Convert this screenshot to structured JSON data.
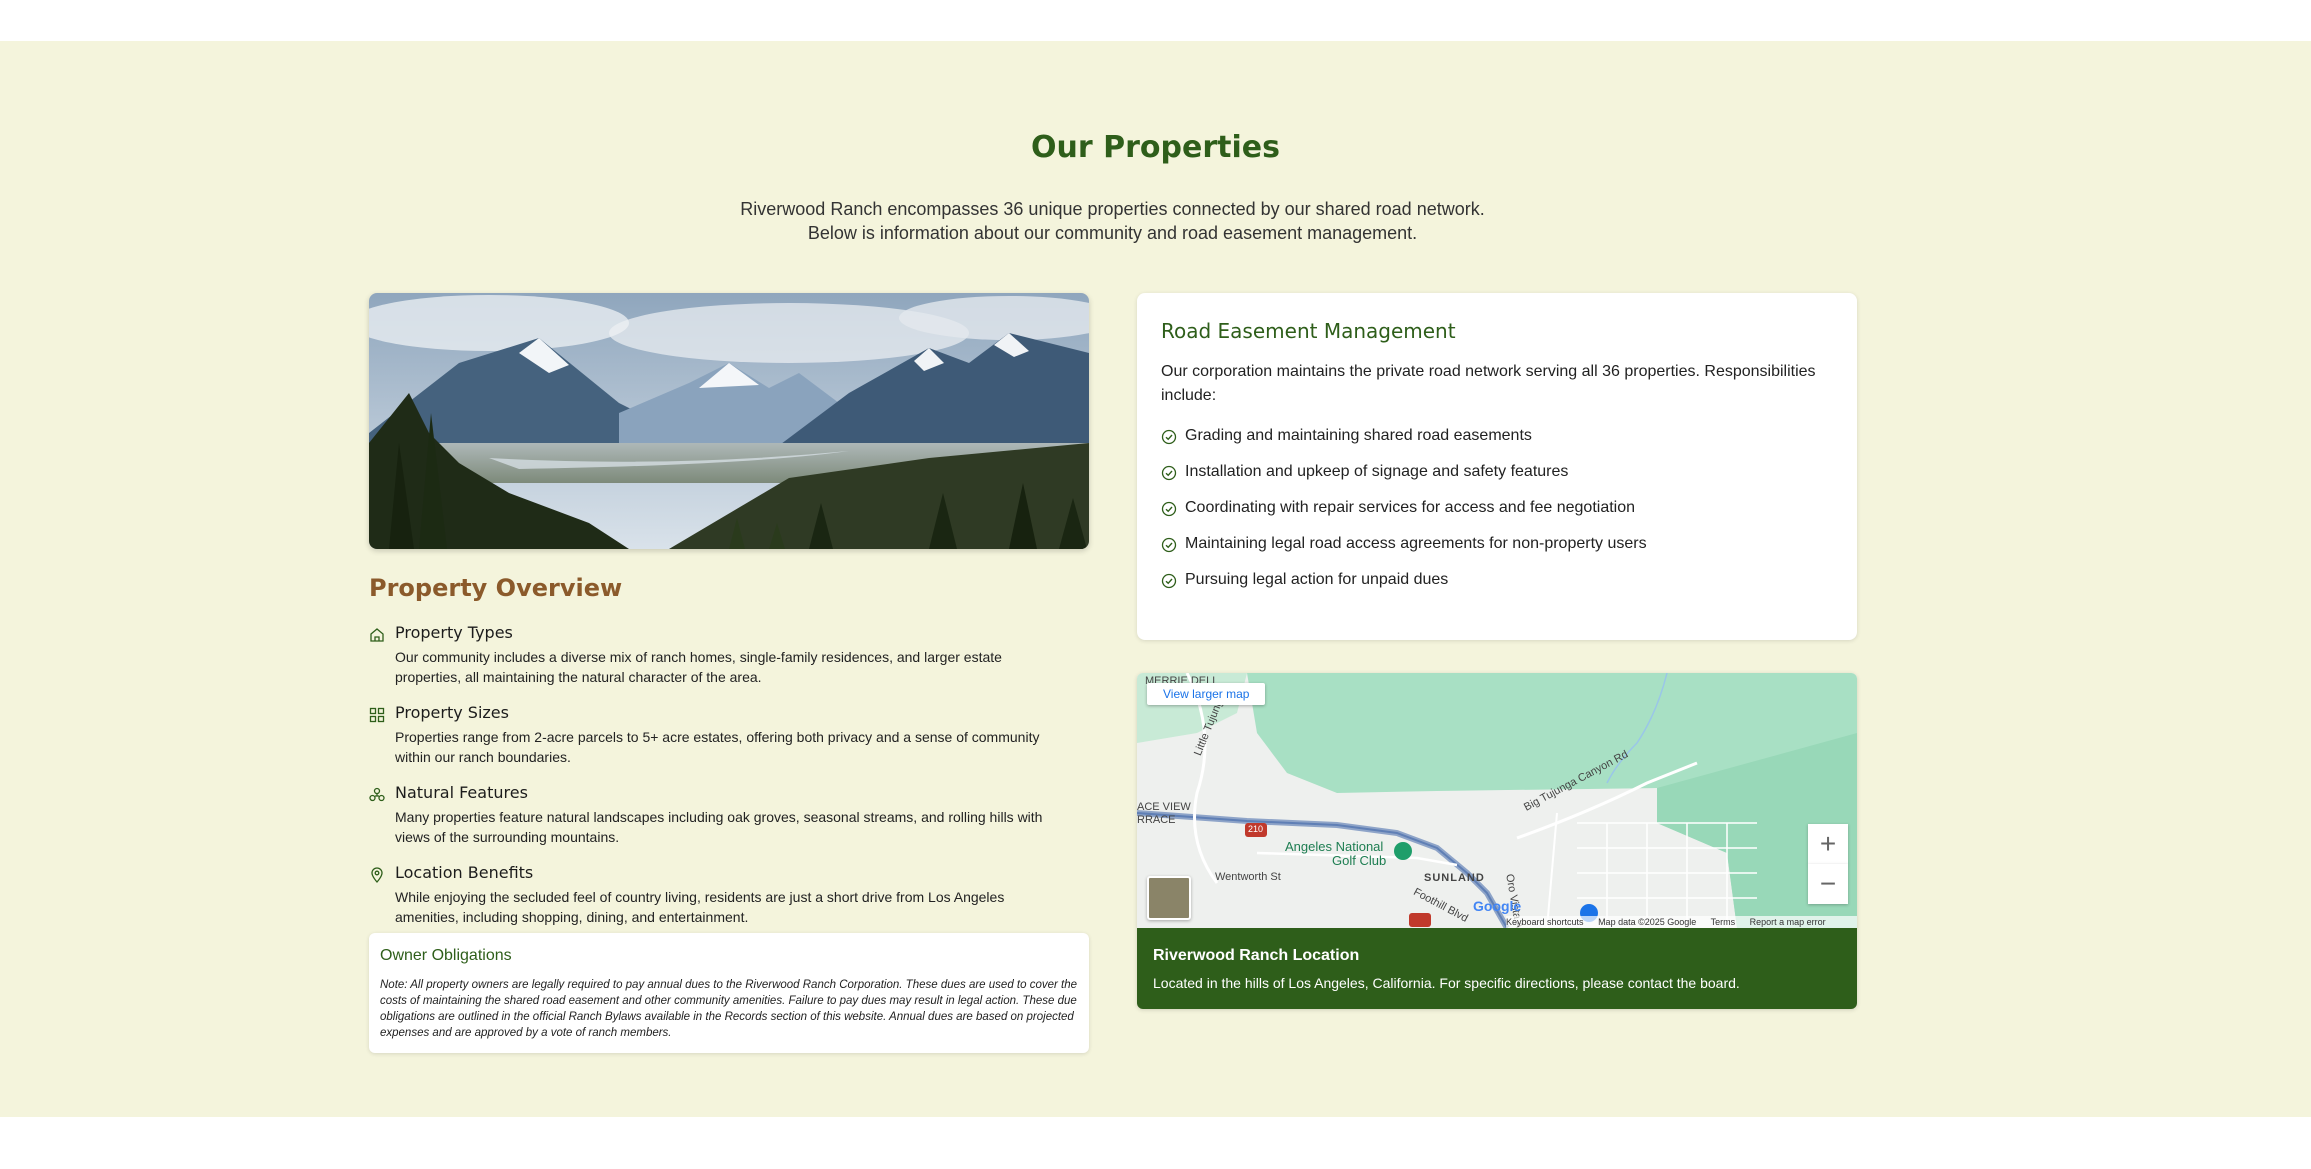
{
  "section": {
    "title": "Our Properties",
    "intro": "Riverwood Ranch encompasses 36 unique properties connected by our shared road network. Below is information about our community and road easement management."
  },
  "overview": {
    "title": "Property Overview",
    "features": [
      {
        "icon": "home-icon",
        "title": "Property Types",
        "text": "Our community includes a diverse mix of ranch homes, single-family residences, and larger estate properties, all maintaining the natural character of the area."
      },
      {
        "icon": "grid-icon",
        "title": "Property Sizes",
        "text": "Properties range from 2-acre parcels to 5+ acre estates, offering both privacy and a sense of community within our ranch boundaries."
      },
      {
        "icon": "tree-icon",
        "title": "Natural Features",
        "text": "Many properties feature natural landscapes including oak groves, seasonal streams, and rolling hills with views of the surrounding mountains."
      },
      {
        "icon": "map-pin-icon",
        "title": "Location Benefits",
        "text": "While enjoying the secluded feel of country living, residents are just a short drive from Los Angeles amenities, including shopping, dining, and entertainment."
      }
    ]
  },
  "obligations": {
    "title": "Owner Obligations",
    "note": "Note: All property owners are legally required to pay annual dues to the Riverwood Ranch Corporation. These dues are used to cover the costs of maintaining the shared road easement and other community amenities. Failure to pay dues may result in legal action. These due obligations are outlined in the official Ranch Bylaws available in the Records section of this website. Annual dues are based on projected expenses and are approved by a vote of ranch members."
  },
  "road": {
    "title": "Road Easement Management",
    "desc": "Our corporation maintains the private road network serving all 36 properties. Responsibilities include:",
    "items": [
      "Grading and maintaining shared road easements",
      "Installation and upkeep of signage and safety features",
      "Coordinating with repair services for access and fee negotiation",
      "Maintaining legal road access agreements for non-property users",
      "Pursuing legal action for unpaid dues"
    ]
  },
  "map": {
    "view_larger": "View larger map",
    "zoom_in": "+",
    "zoom_out": "−",
    "labels": {
      "l1": "ACE VIEW",
      "l2": "RRACE",
      "l3": "Angeles National",
      "l4": "Golf Club",
      "l5": "Wentworth St",
      "l6": "SUNLAND",
      "l7": "Big Tujunga Canyon Rd",
      "l8": "Oro Vista Ave",
      "l9": "Foothill Blvd",
      "l10": "Little Tujunga",
      "l11": "210",
      "l12": "Google",
      "l13": "MERRIE DELL"
    },
    "attribution": {
      "shortcuts": "Keyboard shortcuts",
      "data": "Map data ©2025 Google",
      "terms": "Terms",
      "report": "Report a map error"
    },
    "footer_title": "Riverwood Ranch Location",
    "footer_text": "Located in the hills of Los Angeles, California. For specific directions, please contact the board."
  }
}
